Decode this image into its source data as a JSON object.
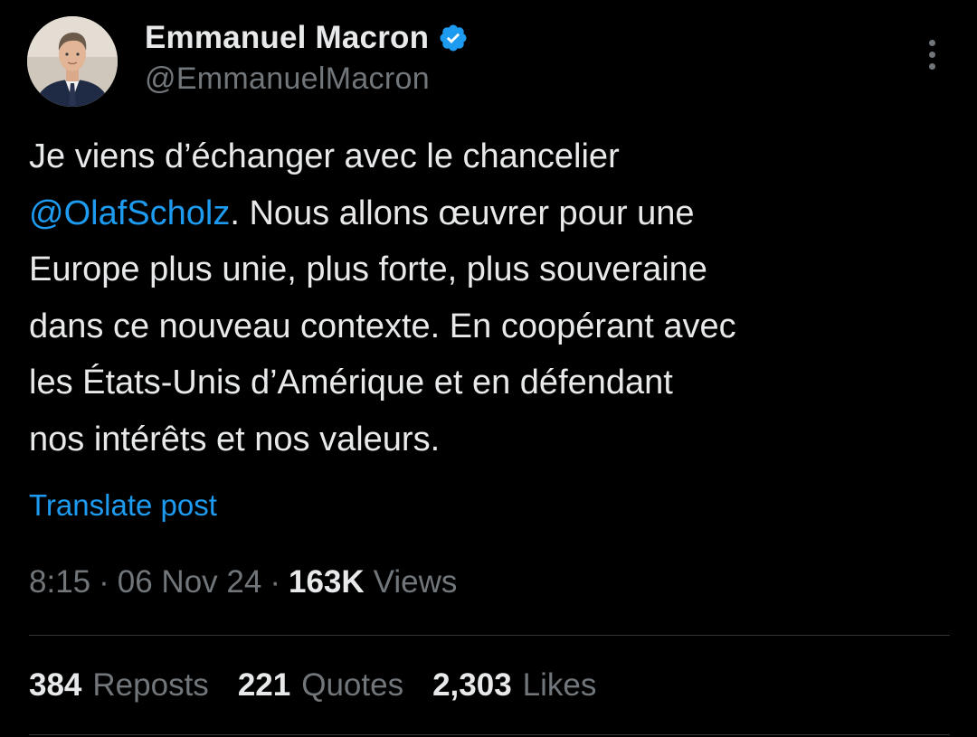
{
  "author": {
    "display_name": "Emmanuel Macron",
    "handle": "@EmmanuelMacron",
    "verified": true,
    "verified_color": "#1d9bf0"
  },
  "post": {
    "lines": [
      {
        "before": "Je viens d’échanger avec le chancelier",
        "mention": "",
        "after": ""
      },
      {
        "before": "",
        "mention": "@OlafScholz",
        "after": ". Nous allons œuvrer pour une"
      },
      {
        "before": "Europe plus unie, plus forte, plus souveraine",
        "mention": "",
        "after": ""
      },
      {
        "before": "dans ce nouveau contexte. En coopérant avec",
        "mention": "",
        "after": ""
      },
      {
        "before": "les États-Unis d’Amérique et en défendant",
        "mention": "",
        "after": ""
      },
      {
        "before": "nos intérêts et nos valeurs.",
        "mention": "",
        "after": ""
      }
    ],
    "translate_label": "Translate post"
  },
  "meta": {
    "time": "8:15",
    "separator": "·",
    "date": "06 Nov 24",
    "views_count": "163K",
    "views_label": "Views"
  },
  "stats": {
    "reposts_count": "384",
    "reposts_label": "Reposts",
    "quotes_count": "221",
    "quotes_label": "Quotes",
    "likes_count": "2,303",
    "likes_label": "Likes"
  },
  "colors": {
    "background": "#000000",
    "primary_text": "#e7e9ea",
    "secondary_text": "#71767b",
    "link": "#1d9bf0",
    "divider": "#2f3336"
  },
  "icons": {
    "verified": "verified-badge-icon",
    "more": "more-options-icon"
  }
}
